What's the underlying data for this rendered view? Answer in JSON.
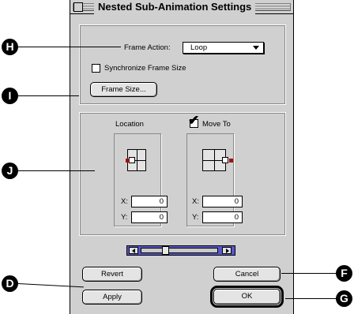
{
  "window": {
    "title": "Nested Sub-Animation Settings"
  },
  "frame_action": {
    "label": "Frame Action:",
    "value": "Loop"
  },
  "synchronize": {
    "label": "Synchronize Frame Size",
    "checked": false
  },
  "frame_size_button": {
    "label": "Frame Size..."
  },
  "location": {
    "label": "Location",
    "x_label": "X:",
    "x_value": "0",
    "y_label": "Y:",
    "y_value": "0"
  },
  "move_to": {
    "label": "Move To",
    "checked": true,
    "check_glyph": "✔",
    "x_label": "X:",
    "x_value": "0",
    "y_label": "Y:",
    "y_value": "0"
  },
  "buttons": {
    "revert": "Revert",
    "apply": "Apply",
    "cancel": "Cancel",
    "ok": "OK"
  },
  "callouts": {
    "h": "H",
    "i": "I",
    "j": "J",
    "d": "D",
    "f": "F",
    "g": "G"
  },
  "colors": {
    "anchor_marker": "#a01010",
    "dialog_bg": "#d0d0d0"
  }
}
